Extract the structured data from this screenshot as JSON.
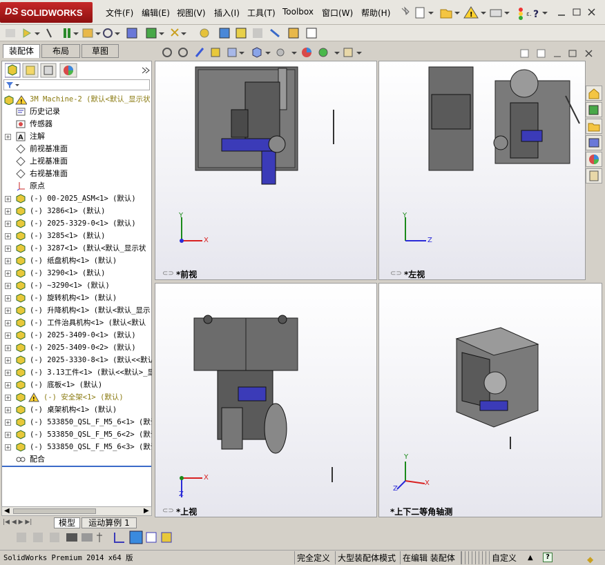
{
  "app": {
    "logo": "SOLIDWORKS",
    "logo_prefix": "DS"
  },
  "menu": [
    "文件(F)",
    "编辑(E)",
    "视图(V)",
    "插入(I)",
    "工具(T)",
    "Toolbox",
    "窗口(W)",
    "帮助(H)"
  ],
  "feature_tabs": [
    "装配体",
    "布局",
    "草图"
  ],
  "tree": {
    "root": "3M Machine-2  (默认<默认_显示状",
    "items": [
      {
        "label": "历史记录",
        "kind": "folder"
      },
      {
        "label": "传感器",
        "kind": "sensor"
      },
      {
        "label": "注解",
        "kind": "annotation",
        "expand": true
      },
      {
        "label": "前视基准面",
        "kind": "plane"
      },
      {
        "label": "上视基准面",
        "kind": "plane"
      },
      {
        "label": "右视基准面",
        "kind": "plane"
      },
      {
        "label": "原点",
        "kind": "origin"
      },
      {
        "label": "(-) 00-2025_ASM<1> (默认)",
        "kind": "asm",
        "expand": true
      },
      {
        "label": "(-) 3286<1> (默认)",
        "kind": "asm",
        "expand": true
      },
      {
        "label": "(-) 2025-3329-0<1> (默认)",
        "kind": "asm",
        "expand": true
      },
      {
        "label": "(-) 3285<1> (默认)",
        "kind": "asm",
        "expand": true
      },
      {
        "label": "(-) 3287<1> (默认<默认_显示状",
        "kind": "asm",
        "expand": true
      },
      {
        "label": "(-) 纸盘机构<1> (默认)",
        "kind": "asm",
        "expand": true
      },
      {
        "label": "(-) 3290<1> (默认)",
        "kind": "asm",
        "expand": true
      },
      {
        "label": "(-) ~3290<1> (默认)",
        "kind": "asm",
        "expand": true
      },
      {
        "label": "(-) 旋转机构<1> (默认)",
        "kind": "asm",
        "expand": true
      },
      {
        "label": "(-) 升降机构<1> (默认<默认_显示",
        "kind": "asm",
        "expand": true
      },
      {
        "label": "(-) 工件治具机构<1> (默认<默认",
        "kind": "asm",
        "expand": true
      },
      {
        "label": "(-) 2025-3409-0<1> (默认)",
        "kind": "asm",
        "expand": true
      },
      {
        "label": "(-) 2025-3409-0<2> (默认)",
        "kind": "asm",
        "expand": true
      },
      {
        "label": "(-) 2025-3330-8<1> (默认<<默认",
        "kind": "asm",
        "expand": true
      },
      {
        "label": "(-) 3.13工件<1> (默认<<默认>_显",
        "kind": "asm",
        "expand": true
      },
      {
        "label": "(-) 底板<1> (默认)",
        "kind": "asm",
        "expand": true
      },
      {
        "label": "(-) 安全架<1> (默认)",
        "kind": "asm-warn",
        "expand": true
      },
      {
        "label": "(-) 桌架机构<1> (默认)",
        "kind": "asm",
        "expand": true
      },
      {
        "label": "(-) 533850_QSL_F_M5_6<1> (默认",
        "kind": "asm",
        "expand": true
      },
      {
        "label": "(-) 533850_QSL_F_M5_6<2> (默认",
        "kind": "asm",
        "expand": true
      },
      {
        "label": "(-) 533850_QSL_F_M5_6<3> (默认",
        "kind": "asm",
        "expand": true
      },
      {
        "label": "配合",
        "kind": "mates"
      }
    ]
  },
  "viewports": {
    "front": {
      "label": "*前视",
      "axis_h": "X",
      "axis_v": "Y"
    },
    "left": {
      "label": "*左视",
      "axis_h": "Z",
      "axis_v": "Y"
    },
    "top": {
      "label": "*上视",
      "axis_h": "X",
      "axis_v": "Z"
    },
    "iso": {
      "label": "*上下二等角轴测",
      "axis_h": "X",
      "axis_v": "Y",
      "axis_d": "Z"
    }
  },
  "bottom_tabs": [
    "模型",
    "运动算例 1"
  ],
  "status": {
    "product": "SolidWorks Premium 2014 x64 版",
    "definition": "完全定义",
    "mode": "大型装配体模式",
    "editing": "在编辑 装配体",
    "units": "自定义"
  },
  "colors": {
    "accent": "#c62828",
    "part_blue": "#3b3bb8",
    "part_gray": "#6c6c6c"
  }
}
